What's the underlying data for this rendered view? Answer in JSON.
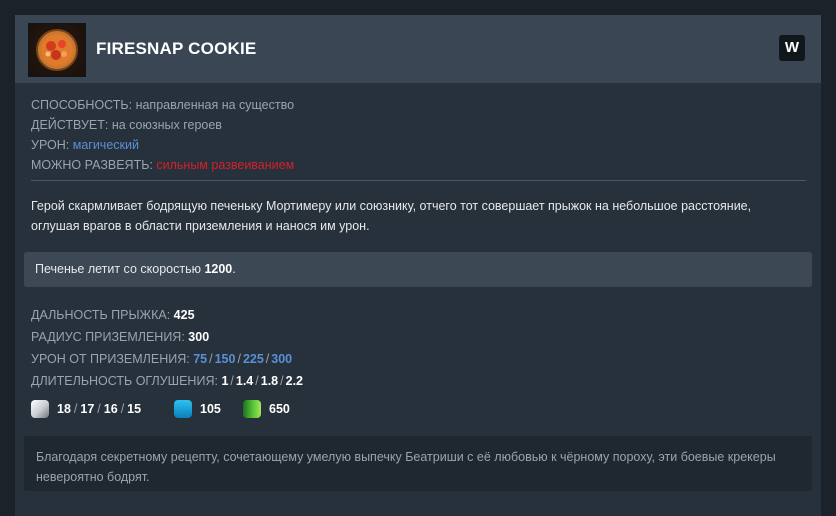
{
  "ability": {
    "name": "FIRESNAP COOKIE",
    "hotkey": "W",
    "icon": "firesnap-cookie-icon"
  },
  "properties": [
    {
      "label": "СПОСОБНОСТЬ:",
      "value": "направленная на существо"
    },
    {
      "label": "ДЕЙСТВУЕТ:",
      "value": "на союзных героев"
    },
    {
      "label": "УРОН:",
      "value": "магический"
    },
    {
      "label": "МОЖНО РАЗВЕЯТЬ:",
      "value": "сильным развеиванием"
    }
  ],
  "description": "Герой скармливает бодрящую печеньку Мортимеру или союзнику, отчего тот совершает прыжок на небольшое расстояние, оглушая врагов в области приземления и нанося им урон.",
  "note": {
    "text": "Печенье летит со скоростью",
    "value": "1200",
    "suffix": "."
  },
  "stats": [
    {
      "label": "ДАЛЬНОСТЬ ПРЫЖКА:",
      "values": [
        "425"
      ]
    },
    {
      "label": "РАДИУС ПРИЗЕМЛЕНИЯ:",
      "values": [
        "300"
      ]
    },
    {
      "label": "УРОН ОТ ПРИЗЕМЛЕНИЯ:",
      "values": [
        "75",
        "150",
        "225",
        "300"
      ]
    },
    {
      "label": "ДЛИТЕЛЬНОСТЬ ОГЛУШЕНИЯ:",
      "values": [
        "1",
        "1.4",
        "1.8",
        "2.2"
      ]
    }
  ],
  "costs": {
    "cooldown": [
      "18",
      "17",
      "16",
      "15"
    ],
    "mana": "105",
    "gold": "650"
  },
  "lore": "Благодаря секретному рецепту, сочетающему умелую выпечку Беатриши с её любовью к чёрному пороху, эти боевые крекеры невероятно бодрят.",
  "colors": {
    "magic": "#5b8fd6",
    "dispel": "#d4202a",
    "header_bg": "#3a4653",
    "card_bg": "#27313b"
  }
}
